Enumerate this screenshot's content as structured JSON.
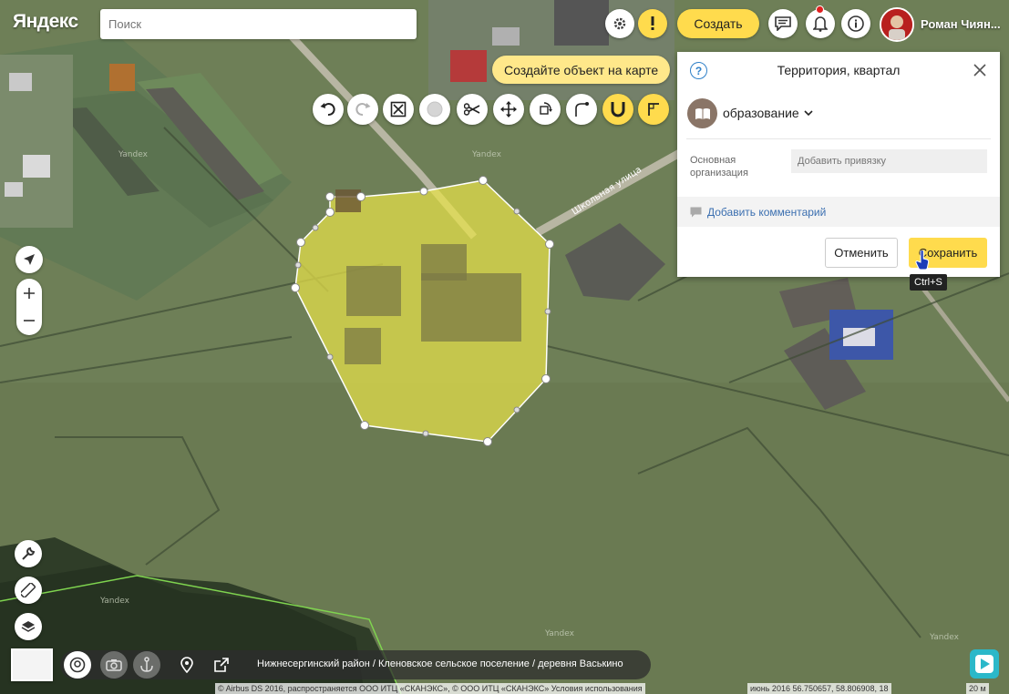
{
  "header": {
    "logo": "Яндекс",
    "search_placeholder": "Поиск",
    "create_label": "Создать",
    "user_name": "Роман Чиян..."
  },
  "hint": "Создайте объект на карте",
  "map": {
    "street_label": "Школьная улица",
    "watermark": "Yandex"
  },
  "toolbar": {
    "tools": [
      {
        "name": "undo-icon"
      },
      {
        "name": "redo-icon"
      },
      {
        "name": "delete-object-icon"
      },
      {
        "name": "circle-icon"
      },
      {
        "name": "scissors-icon"
      },
      {
        "name": "move-icon"
      },
      {
        "name": "rotate-icon"
      },
      {
        "name": "curve-icon"
      },
      {
        "name": "magnet-icon"
      },
      {
        "name": "angle-icon"
      }
    ]
  },
  "panel": {
    "title": "Территория, квартал",
    "category": "образование",
    "field_label": "Основная организация",
    "field_placeholder": "Добавить привязку",
    "comment_label": "Добавить комментарий",
    "cancel_label": "Отменить",
    "save_label": "Сохранить",
    "save_shortcut": "Ctrl+S"
  },
  "bottom": {
    "breadcrumb": "Нижнесергинский район / Кленовское сельское поселение / деревня Васькино",
    "copyright": "© Airbus DS 2016, распространяется ООО ИТЦ «СКАНЭКС», © ООО ИТЦ «СКАНЭКС» Условия использования",
    "date_coords": "июнь 2016  56.750657, 58.806908, 18",
    "scale": "20 м"
  },
  "colors": {
    "accent": "#ffdb4d",
    "polygon_fill": "#e7e24a",
    "link": "#3b6fb0"
  }
}
